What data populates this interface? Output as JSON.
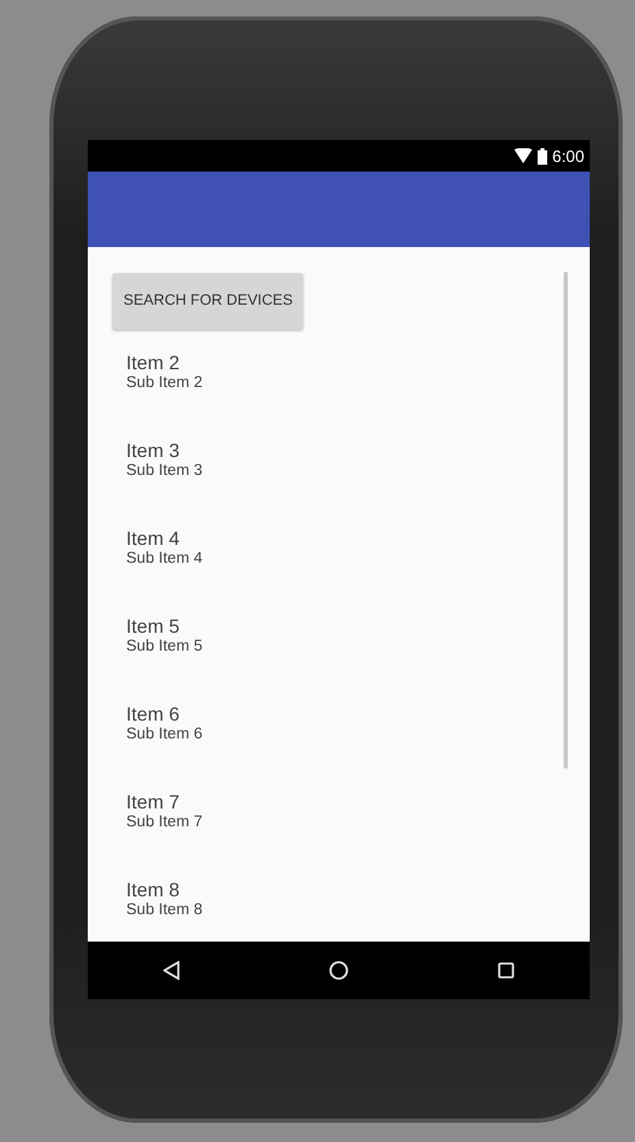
{
  "status_bar": {
    "time": "6:00"
  },
  "search_button": {
    "label": "SEARCH FOR DEVICES"
  },
  "items": [
    {
      "title": "Item 2",
      "subtitle": "Sub Item 2"
    },
    {
      "title": "Item 3",
      "subtitle": "Sub Item 3"
    },
    {
      "title": "Item 4",
      "subtitle": "Sub Item 4"
    },
    {
      "title": "Item 5",
      "subtitle": "Sub Item 5"
    },
    {
      "title": "Item 6",
      "subtitle": "Sub Item 6"
    },
    {
      "title": "Item 7",
      "subtitle": "Sub Item 7"
    },
    {
      "title": "Item 8",
      "subtitle": "Sub Item 8"
    }
  ]
}
